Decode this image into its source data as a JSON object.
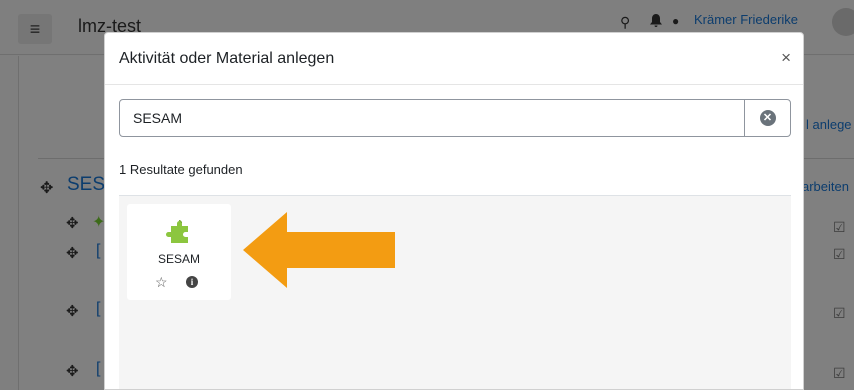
{
  "background": {
    "navbar": {
      "menu_icon": "≡",
      "site_name": "lmz-test",
      "search_icon": "⚲",
      "bell_icon": "🔔",
      "message_icon": "●",
      "user_name": "Krämer Friederike"
    },
    "add_link_partial": "l anlege",
    "section": {
      "move_icon": "✥",
      "title_partial": "SES",
      "edit_link_partial": "arbeiten"
    },
    "row_move_icon": "✥",
    "checkbox_icon": "☑"
  },
  "modal": {
    "title": "Aktivität oder Material anlegen",
    "close_icon": "×",
    "search": {
      "value": "SESAM",
      "clear_icon": "✕"
    },
    "results_count": "1 Resultate gefunden",
    "results": [
      {
        "name": "SESAM",
        "icon": "puzzle-icon",
        "star_icon": "☆",
        "info_icon": "i"
      }
    ]
  },
  "colors": {
    "arrow": "#f39c12",
    "puzzle": "#8cc63f",
    "link": "#0f6cbf"
  }
}
